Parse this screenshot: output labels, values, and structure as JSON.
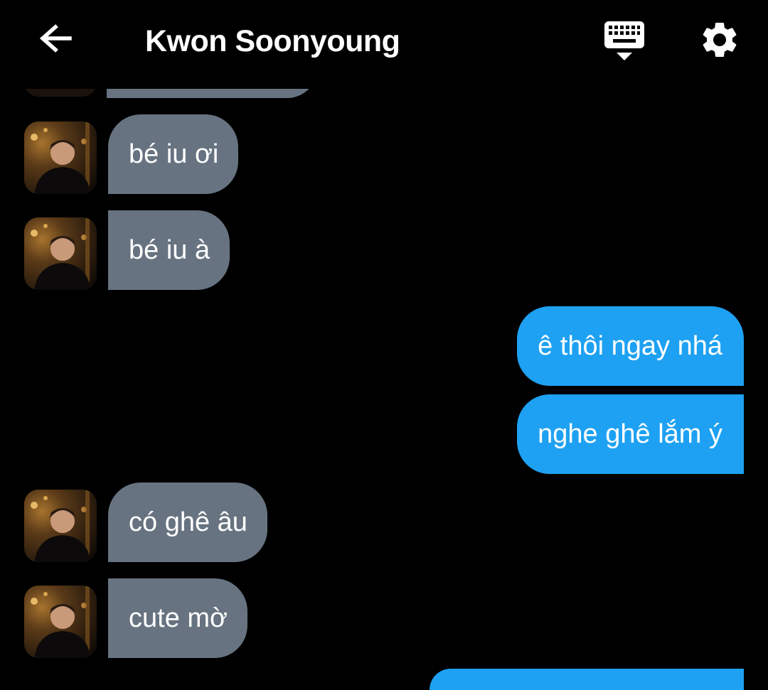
{
  "header": {
    "title": "Kwon Soonyoung",
    "back_icon": "arrow-left-icon",
    "keyboard_icon": "keyboard-hide-icon",
    "settings_icon": "gear-icon"
  },
  "colors": {
    "background": "#000000",
    "incoming_bubble": "#677380",
    "outgoing_bubble": "#1ea1f2",
    "text": "#ffffff"
  },
  "messages": [
    {
      "side": "in",
      "text": "bé iu ơi"
    },
    {
      "side": "in",
      "text": "bé iu à"
    },
    {
      "side": "out",
      "text": "ê thôi ngay nhá"
    },
    {
      "side": "out",
      "text": "nghe ghê lắm ý"
    },
    {
      "side": "in",
      "text": "có ghê âu"
    },
    {
      "side": "in",
      "text": "cute mờ"
    }
  ]
}
